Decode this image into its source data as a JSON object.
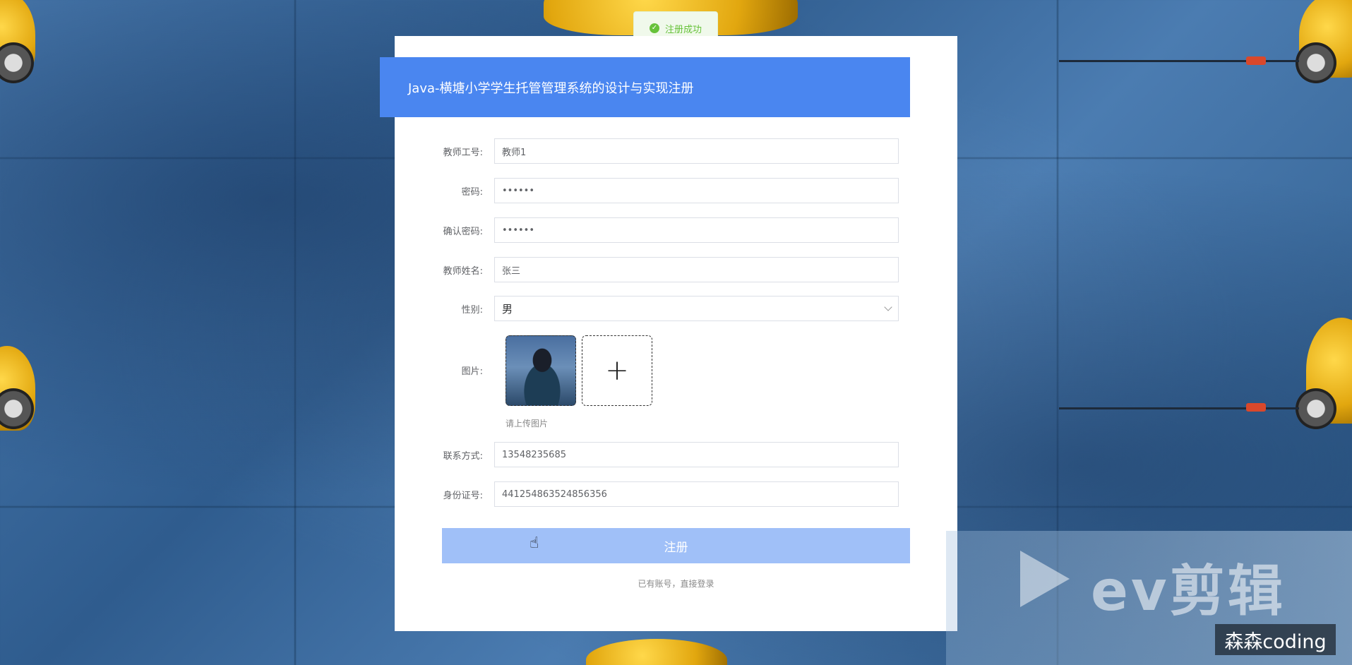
{
  "toast": {
    "message": "注册成功",
    "icon": "check-circle-icon",
    "color": "#67c23a"
  },
  "title": "Java-横塘小学学生托管管理系统的设计与实现注册",
  "form": {
    "teacher_id": {
      "label": "教师工号:",
      "value": "教师1"
    },
    "password": {
      "label": "密码:",
      "value": "••••••"
    },
    "confirm_password": {
      "label": "确认密码:",
      "value": "••••••"
    },
    "teacher_name": {
      "label": "教师姓名:",
      "value": "张三"
    },
    "gender": {
      "label": "性别:",
      "value": "男"
    },
    "image": {
      "label": "图片:",
      "add_symbol": "+",
      "hint": "请上传图片"
    },
    "contact": {
      "label": "联系方式:",
      "value": "13548235685"
    },
    "id_number": {
      "label": "身份证号:",
      "value": "441254863524856356"
    }
  },
  "submit_label": "注册",
  "login_link": "已有账号，直接登录",
  "watermark": {
    "logo_text": "ev剪辑",
    "credit": "森森coding"
  },
  "colors": {
    "primary": "#4a86f0",
    "button_disabled": "#a0c0f8",
    "success": "#67c23a"
  }
}
